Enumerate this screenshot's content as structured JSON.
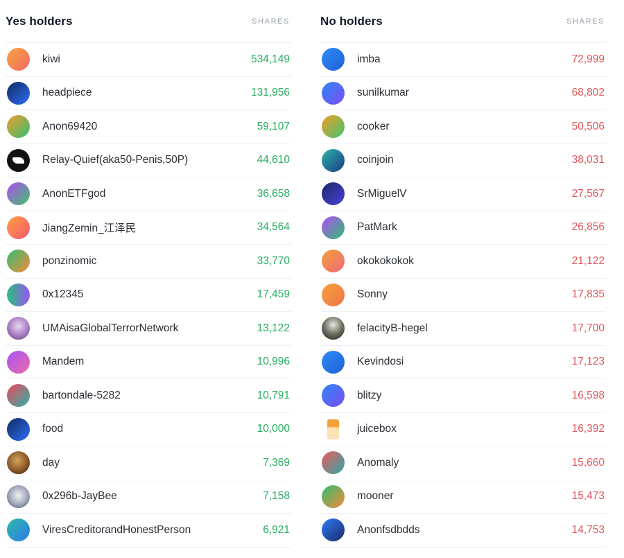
{
  "yes": {
    "title": "Yes holders",
    "subtitle": "SHARES",
    "rows": [
      {
        "name": "kiwi",
        "shares": "534,149"
      },
      {
        "name": "headpiece",
        "shares": "131,956"
      },
      {
        "name": "Anon69420",
        "shares": "59,107"
      },
      {
        "name": "Relay-Quief(aka50-Penis,50P)",
        "shares": "44,610"
      },
      {
        "name": "AnonETFgod",
        "shares": "36,658"
      },
      {
        "name": "JiangZemin_江泽民",
        "shares": "34,564"
      },
      {
        "name": "ponzinomic",
        "shares": "33,770"
      },
      {
        "name": "0x12345",
        "shares": "17,459"
      },
      {
        "name": "UMAisaGlobalTerrorNetwork",
        "shares": "13,122"
      },
      {
        "name": "Mandem",
        "shares": "10,996"
      },
      {
        "name": "bartondale-5282",
        "shares": "10,791"
      },
      {
        "name": "food",
        "shares": "10,000"
      },
      {
        "name": "day",
        "shares": "7,369"
      },
      {
        "name": "0x296b-JayBee",
        "shares": "7,158"
      },
      {
        "name": "ViresCreditorandHonestPerson",
        "shares": "6,921"
      }
    ]
  },
  "no": {
    "title": "No holders",
    "subtitle": "SHARES",
    "rows": [
      {
        "name": "imba",
        "shares": "72,999"
      },
      {
        "name": "sunilkumar",
        "shares": "68,802"
      },
      {
        "name": "cooker",
        "shares": "50,506"
      },
      {
        "name": "coinjoin",
        "shares": "38,031"
      },
      {
        "name": "SrMiguelV",
        "shares": "27,567"
      },
      {
        "name": "PatMark",
        "shares": "26,856"
      },
      {
        "name": "okokokokok",
        "shares": "21,122"
      },
      {
        "name": "Sonny",
        "shares": "17,835"
      },
      {
        "name": "felacityB-hegel",
        "shares": "17,700"
      },
      {
        "name": "Kevindosi",
        "shares": "17,123"
      },
      {
        "name": "blitzy",
        "shares": "16,598"
      },
      {
        "name": "juicebox",
        "shares": "16,392"
      },
      {
        "name": "Anomaly",
        "shares": "15,660"
      },
      {
        "name": "mooner",
        "shares": "15,473"
      },
      {
        "name": "Anonfsdbdds",
        "shares": "14,753"
      }
    ]
  }
}
